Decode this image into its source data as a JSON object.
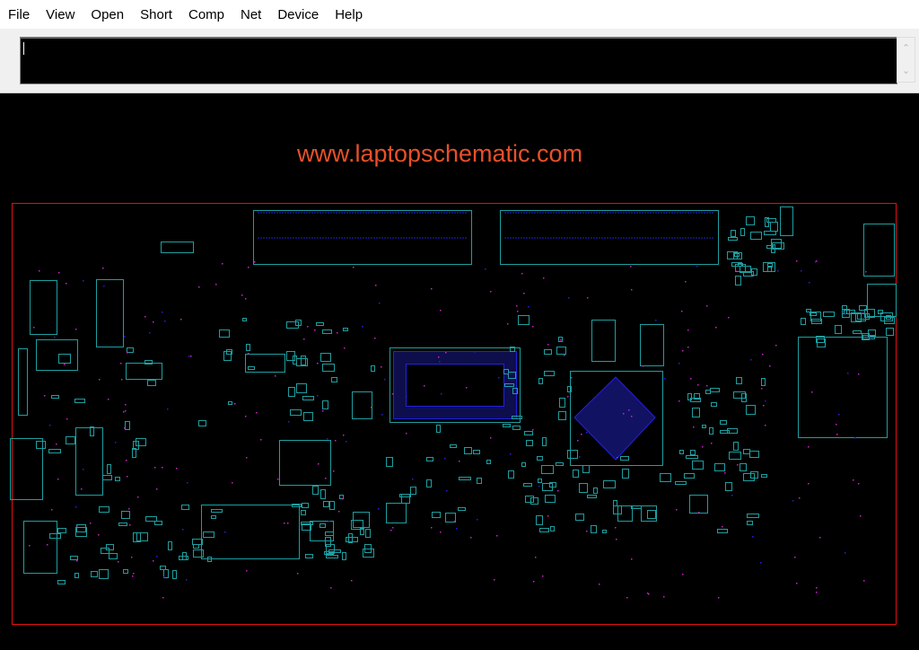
{
  "menu": {
    "items": [
      "File",
      "View",
      "Open",
      "Short",
      "Comp",
      "Net",
      "Device",
      "Help"
    ]
  },
  "command_input": {
    "value": ""
  },
  "watermark": "www.laptopschematic.com",
  "colors": {
    "board_outline": "#e01010",
    "component_outline": "#1e9ea0",
    "pin": "#2222dd",
    "via": "#cc22cc",
    "watermark": "#e8502a",
    "background": "#000000"
  }
}
